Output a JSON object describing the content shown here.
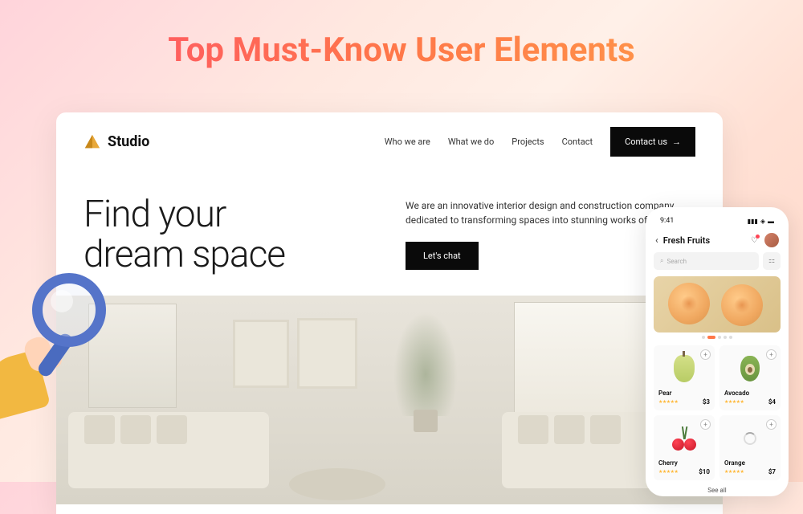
{
  "banner": {
    "title": "Top Must-Know User Elements"
  },
  "website": {
    "logo": "Studio",
    "nav": [
      "Who we are",
      "What we do",
      "Projects",
      "Contact"
    ],
    "cta": "Contact us",
    "hero": {
      "line1": "Find your",
      "line2": "dream space",
      "desc": "We are an innovative interior design and construction company dedicated to transforming spaces into stunning works of art.",
      "chat": "Let's chat"
    }
  },
  "mobile": {
    "time": "9:41",
    "title": "Fresh Fruits",
    "search_placeholder": "Search",
    "products": [
      {
        "name": "Pear",
        "price": "$3"
      },
      {
        "name": "Avocado",
        "price": "$4"
      },
      {
        "name": "Cherry",
        "price": "$10"
      },
      {
        "name": "Orange",
        "price": "$7"
      }
    ],
    "seeall": "See all"
  }
}
